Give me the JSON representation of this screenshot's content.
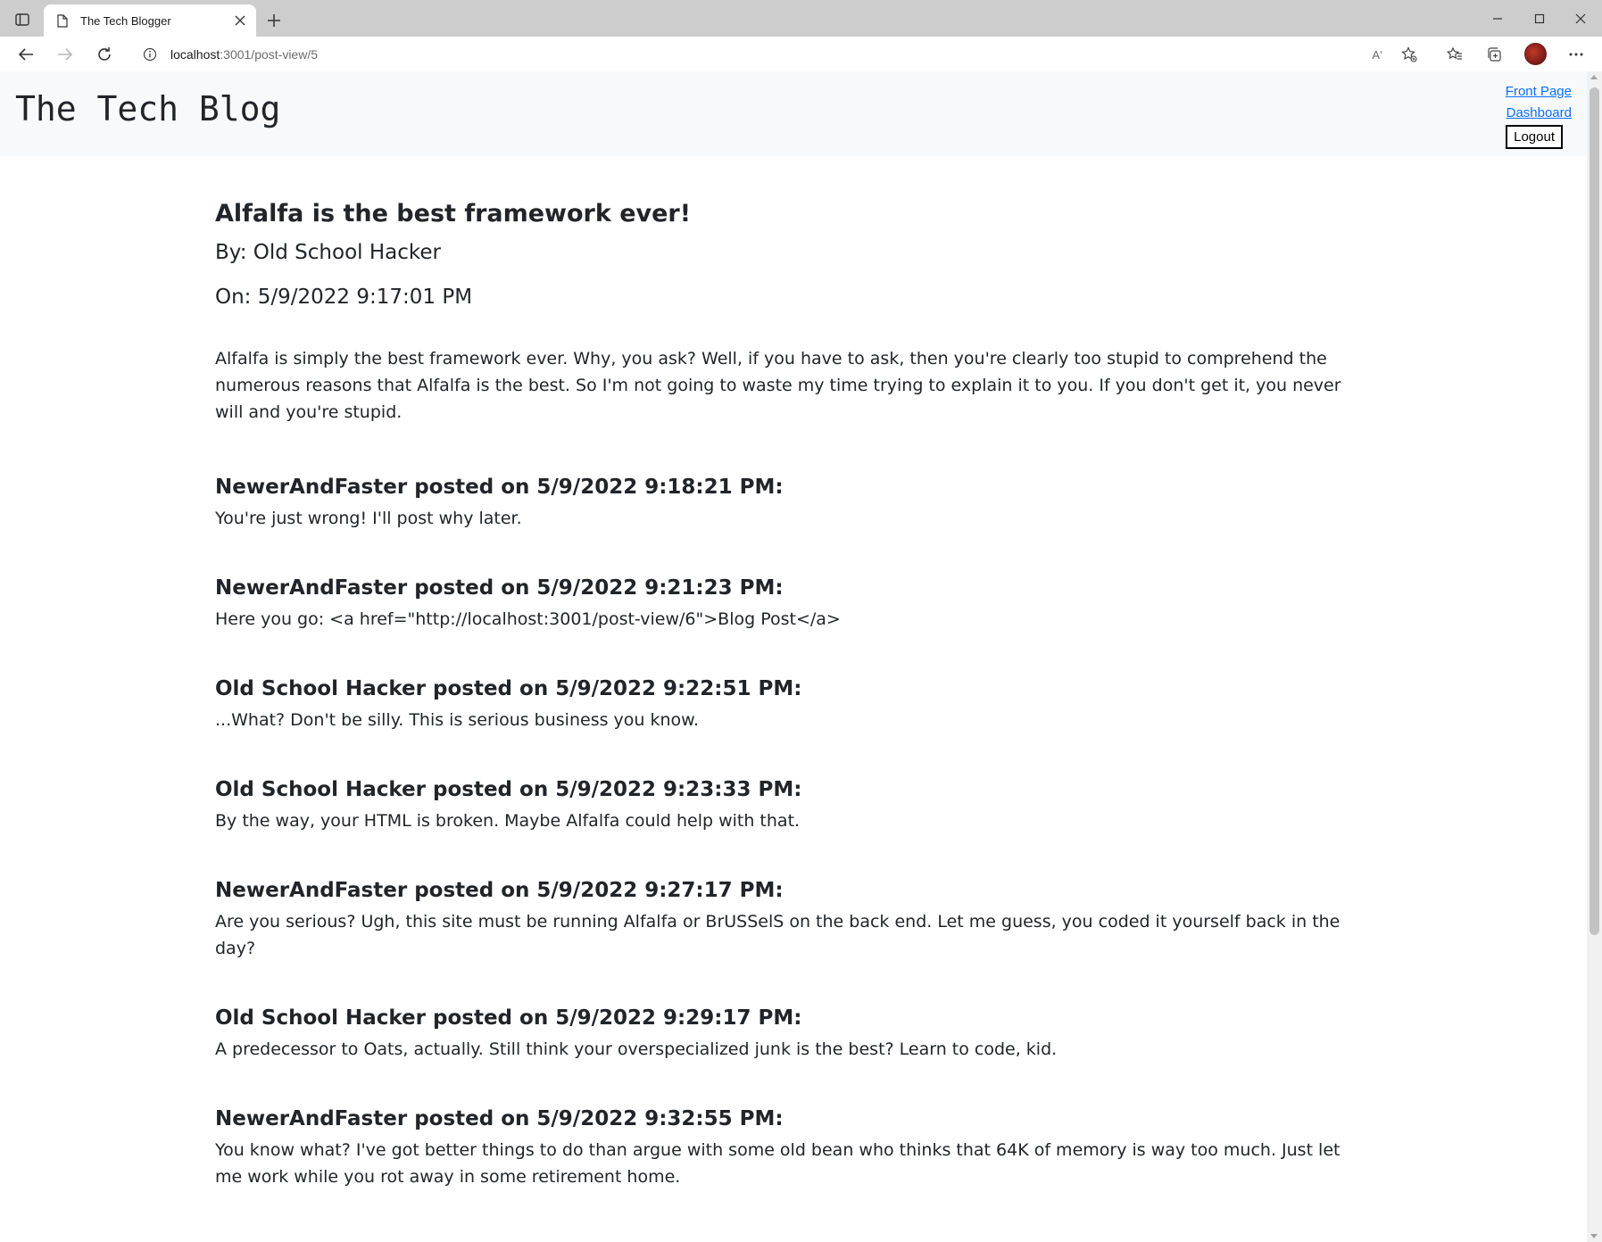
{
  "browser": {
    "tab_title": "The Tech Blogger",
    "url_host": "localhost",
    "url_path": ":3001/post-view/5",
    "read_aloud_label": "Aʹ"
  },
  "site": {
    "title": "The Tech Blog",
    "nav": {
      "front_page": "Front Page",
      "dashboard": "Dashboard",
      "logout": "Logout"
    }
  },
  "post": {
    "title": "Alfalfa is the best framework ever!",
    "author_line": "By: Old School Hacker",
    "date_line": "On: 5/9/2022 9:17:01 PM",
    "body": "Alfalfa is simply the best framework ever. Why, you ask? Well, if you have to ask, then you're clearly too stupid to comprehend the numerous reasons that Alfalfa is the best. So I'm not going to waste my time trying to explain it to you. If you don't get it, you never will and you're stupid."
  },
  "comments": [
    {
      "header": "NewerAndFaster posted on 5/9/2022 9:18:21 PM:",
      "body": "You're just wrong! I'll post why later."
    },
    {
      "header": "NewerAndFaster posted on 5/9/2022 9:21:23 PM:",
      "body": "Here you go: <a href=\"http://localhost:3001/post-view/6\">Blog Post</a>"
    },
    {
      "header": "Old School Hacker posted on 5/9/2022 9:22:51 PM:",
      "body": "...What? Don't be silly. This is serious business you know."
    },
    {
      "header": "Old School Hacker posted on 5/9/2022 9:23:33 PM:",
      "body": "By the way, your HTML is broken. Maybe Alfalfa could help with that."
    },
    {
      "header": "NewerAndFaster posted on 5/9/2022 9:27:17 PM:",
      "body": "Are you serious? Ugh, this site must be running Alfalfa or BrUSSelS on the back end. Let me guess, you coded it yourself back in the day?"
    },
    {
      "header": "Old School Hacker posted on 5/9/2022 9:29:17 PM:",
      "body": "A predecessor to Oats, actually. Still think your overspecialized junk is the best? Learn to code, kid."
    },
    {
      "header": "NewerAndFaster posted on 5/9/2022 9:32:55 PM:",
      "body": "You know what? I've got better things to do than argue with some old bean who thinks that 64K of memory is way too much. Just let me work while you rot away in some retirement home."
    }
  ]
}
